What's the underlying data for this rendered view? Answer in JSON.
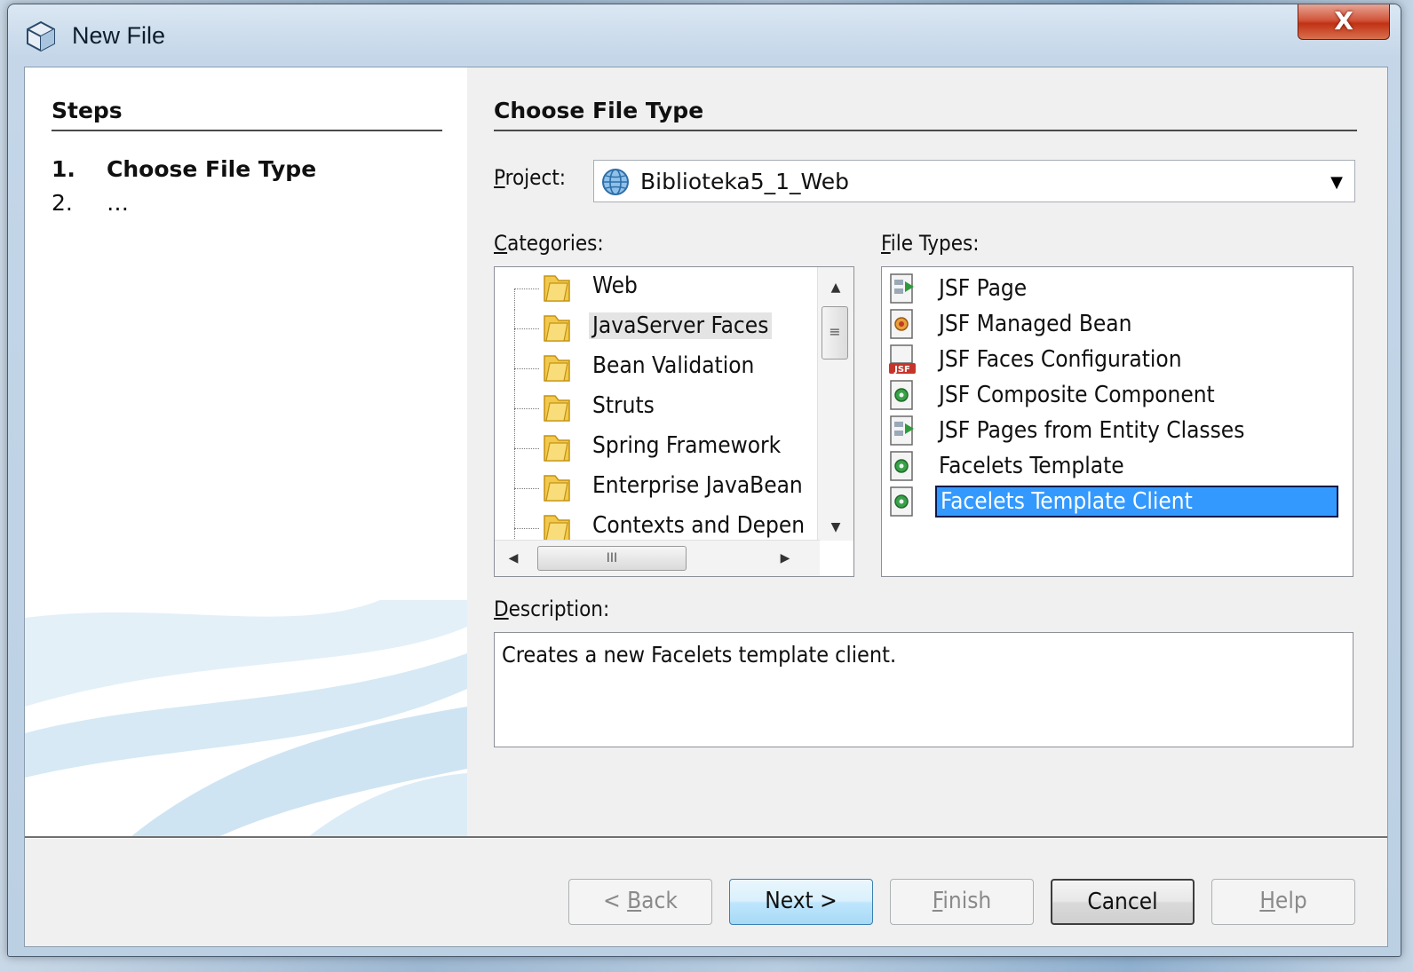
{
  "window": {
    "title": "New File",
    "close_label": "X"
  },
  "steps": {
    "heading": "Steps",
    "items": [
      {
        "num": "1.",
        "label": "Choose File Type"
      },
      {
        "num": "2.",
        "label": "…"
      }
    ]
  },
  "main": {
    "heading": "Choose File Type",
    "project": {
      "label_prefix": "P",
      "label_rest": "roject:",
      "value": "Biblioteka5_1_Web"
    },
    "categories": {
      "label_prefix": "C",
      "label_rest": "ategories:",
      "items": [
        {
          "label": "Web",
          "selected": false
        },
        {
          "label": "JavaServer Faces",
          "selected": true
        },
        {
          "label": "Bean Validation",
          "selected": false
        },
        {
          "label": "Struts",
          "selected": false
        },
        {
          "label": "Spring Framework",
          "selected": false
        },
        {
          "label": "Enterprise JavaBean",
          "selected": false
        },
        {
          "label": "Contexts and Depen",
          "selected": false
        }
      ]
    },
    "file_types": {
      "label_prefix": "F",
      "label_rest": "ile Types:",
      "items": [
        {
          "label": "JSF Page",
          "icon": "jsf-page-icon",
          "selected": false
        },
        {
          "label": "JSF Managed Bean",
          "icon": "managed-bean-icon",
          "selected": false
        },
        {
          "label": "JSF Faces Configuration",
          "icon": "faces-config-icon",
          "selected": false
        },
        {
          "label": "JSF Composite Component",
          "icon": "composite-component-icon",
          "selected": false
        },
        {
          "label": "JSF Pages from Entity Classes",
          "icon": "entity-pages-icon",
          "selected": false
        },
        {
          "label": "Facelets Template",
          "icon": "facelets-template-icon",
          "selected": false
        },
        {
          "label": "Facelets Template Client",
          "icon": "facelets-client-icon",
          "selected": true
        }
      ]
    },
    "description": {
      "label_prefix": "D",
      "label_rest": "escription:",
      "text": "Creates a new Facelets template client."
    }
  },
  "buttons": {
    "back": {
      "pre": "< ",
      "mnemonic": "B",
      "post": "ack"
    },
    "next": {
      "label": "Next >"
    },
    "finish": {
      "pre": "",
      "mnemonic": "F",
      "post": "inish"
    },
    "cancel": {
      "label": "Cancel"
    },
    "help": {
      "pre": "",
      "mnemonic": "H",
      "post": "elp"
    }
  },
  "colors": {
    "selection": "#3399ff",
    "close_button": "#c03214",
    "default_button": "#bee6fd"
  }
}
